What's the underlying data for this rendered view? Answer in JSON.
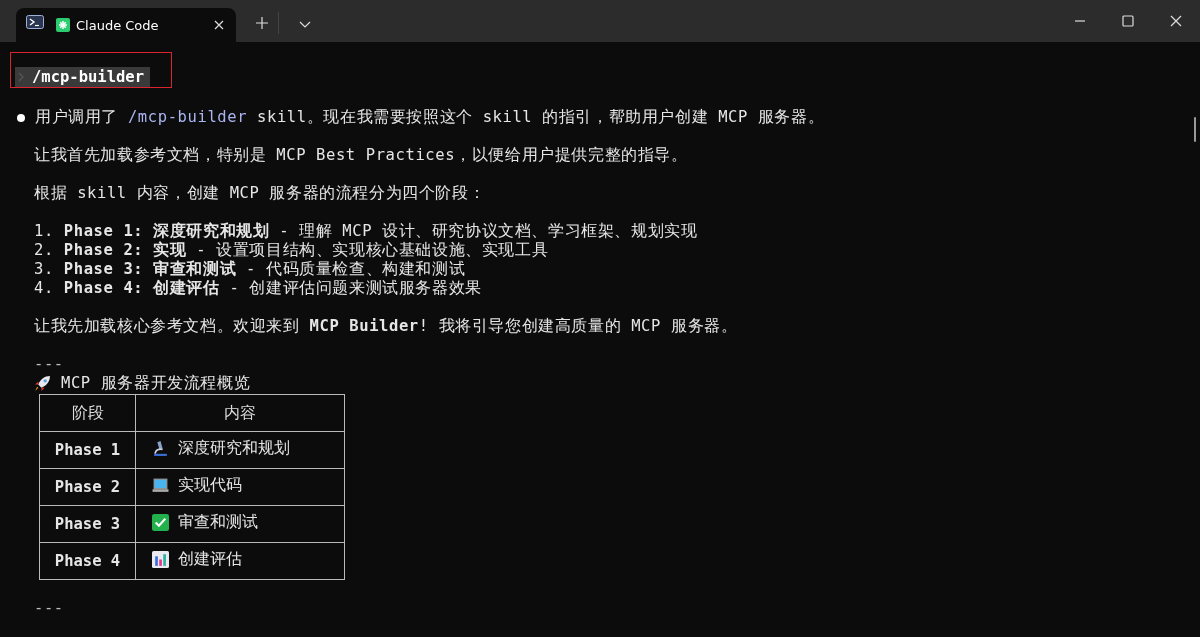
{
  "tab": {
    "title": "Claude Code",
    "selected": true
  },
  "prompt": {
    "text": "/mcp-builder",
    "annotated": true
  },
  "message": [
    {
      "kind": "bullet",
      "segments": [
        {
          "kind": "plain",
          "text": "用户调用了 "
        },
        {
          "kind": "command",
          "text": "/mcp-builder"
        },
        {
          "kind": "plain",
          "text": " skill。现在我需要按照这个 skill 的指引，帮助用户创建 MCP 服务器。"
        }
      ]
    },
    {
      "kind": "paragraph",
      "text": "让我首先加载参考文档，特别是 MCP Best Practices，以便给用户提供完整的指导。"
    },
    {
      "kind": "paragraph",
      "text": "根据 skill 内容，创建 MCP 服务器的流程分为四个阶段："
    },
    {
      "kind": "list",
      "items": [
        "1. **Phase 1: 深度研究和规划** - 理解 MCP 设计、研究协议文档、学习框架、规划实现",
        "2. **Phase 2: 实现** - 设置项目结构、实现核心基础设施、实现工具",
        "3. **Phase 3: 审查和测试** - 代码质量检查、构建和测试",
        "4. **Phase 4: 创建评估** - 创建评估问题来测试服务器效果"
      ]
    },
    {
      "kind": "paragraph",
      "text": "让我先加载核心参考文档。欢迎来到 **MCP Builder**! 我将引导您创建高质量的 MCP 服务器。"
    },
    {
      "kind": "rule",
      "text": "---"
    },
    {
      "kind": "heading",
      "text": "MCP 服务器开发流程概览"
    },
    {
      "kind": "table",
      "columns": [
        "阶段",
        "内容"
      ],
      "rows": [
        {
          "phase": "Phase 1",
          "kind": "microscope",
          "content": "深度研究和规划"
        },
        {
          "phase": "Phase 2",
          "kind": "laptop",
          "content": "实现代码"
        },
        {
          "phase": "Phase 3",
          "kind": "check",
          "content": "审查和测试"
        },
        {
          "phase": "Phase 4",
          "kind": "chart",
          "content": "创建评估"
        }
      ]
    },
    {
      "kind": "rule",
      "text": "---"
    }
  ]
}
